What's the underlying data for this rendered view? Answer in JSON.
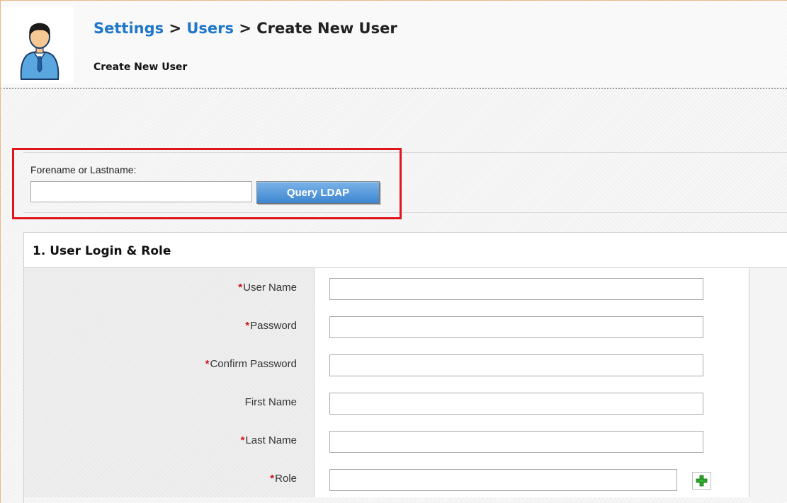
{
  "header": {
    "breadcrumb": {
      "items": [
        "Settings",
        "Users",
        "Create New User"
      ],
      "separator": ">"
    },
    "subtitle": "Create New User",
    "avatar_icon": "user-avatar-icon"
  },
  "ldap": {
    "label": "Forename or Lastname:",
    "input_value": "",
    "button_label": "Query LDAP",
    "highlight_color": "#e0141b"
  },
  "section": {
    "title": "1. User Login & Role",
    "required_marker": "*",
    "rows": [
      {
        "label": "User Name",
        "required": true,
        "value": ""
      },
      {
        "label": "Password",
        "required": true,
        "value": ""
      },
      {
        "label": "Confirm Password",
        "required": true,
        "value": ""
      },
      {
        "label": "First Name",
        "required": false,
        "value": ""
      },
      {
        "label": "Last Name",
        "required": true,
        "value": ""
      },
      {
        "label": "Role",
        "required": true,
        "value": "",
        "add_icon": "plus-icon"
      }
    ]
  },
  "colors": {
    "link": "#1f77c9",
    "required": "#d0141b",
    "button": "#3d86d0",
    "add_icon": "#2aa52a"
  }
}
